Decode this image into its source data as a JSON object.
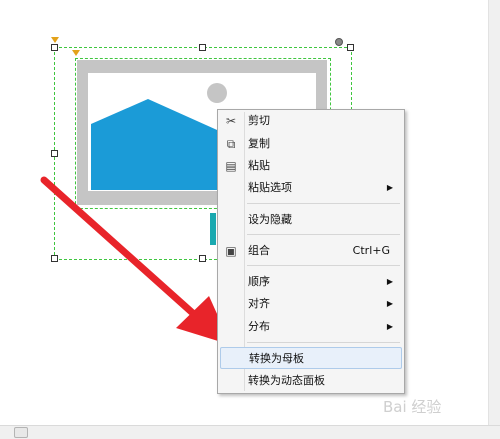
{
  "colors": {
    "selection": "#3fc63f",
    "image_shape": "#1b9bd7",
    "arrow": "#e8242a",
    "menu_highlight": "#e8f0fa"
  },
  "context_menu": {
    "items": [
      {
        "label": "剪切",
        "icon": "scissors-icon"
      },
      {
        "label": "复制",
        "icon": "copy-icon"
      },
      {
        "label": "粘贴",
        "icon": "paste-icon"
      },
      {
        "label": "粘贴选项",
        "submenu": true
      },
      {
        "label": "设为隐藏"
      },
      {
        "label": "组合",
        "shortcut": "Ctrl+G",
        "icon": "group-icon"
      },
      {
        "label": "顺序",
        "submenu": true
      },
      {
        "label": "对齐",
        "submenu": true
      },
      {
        "label": "分布",
        "submenu": true
      },
      {
        "label": "转换为母板",
        "highlighted": true
      },
      {
        "label": "转换为动态面板"
      }
    ]
  },
  "watermark": "Bai 经验"
}
